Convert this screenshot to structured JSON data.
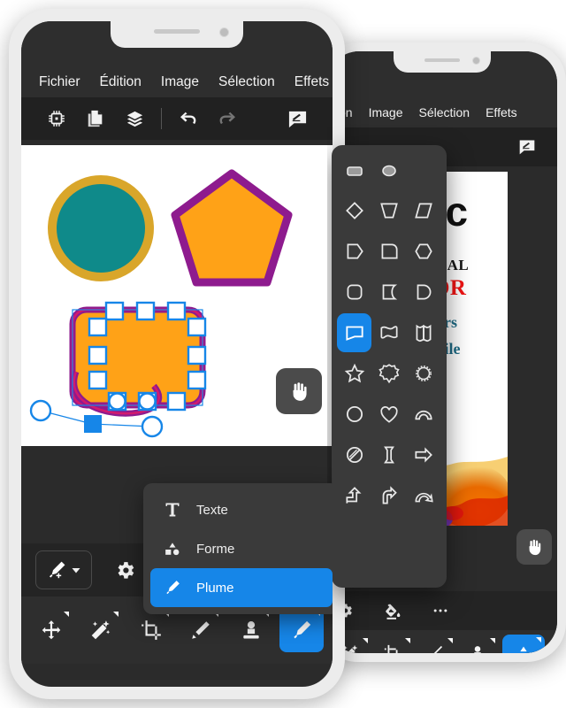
{
  "app": {
    "accent_color": "#1686e8",
    "panel_color": "#3a3a3a",
    "chrome_color": "#2e2e2e",
    "toolbar_color": "#212121"
  },
  "front_phone": {
    "menubar": {
      "items": [
        {
          "label": "Fichier",
          "name": "menu-fichier"
        },
        {
          "label": "Édition",
          "name": "menu-edition"
        },
        {
          "label": "Image",
          "name": "menu-image"
        },
        {
          "label": "Sélection",
          "name": "menu-selection"
        },
        {
          "label": "Effets",
          "name": "menu-effets"
        }
      ]
    },
    "toolbar": {
      "items": [
        {
          "icon": "chip-icon",
          "name": "tool-chip"
        },
        {
          "icon": "documents-icon",
          "name": "tool-documents"
        },
        {
          "icon": "layers-icon",
          "name": "tool-layers"
        },
        {
          "icon": "undo-icon",
          "name": "tool-undo"
        },
        {
          "icon": "redo-icon",
          "name": "tool-redo",
          "disabled": true
        },
        {
          "icon": "signature-icon",
          "name": "tool-signature"
        }
      ]
    },
    "canvas": {
      "shapes": [
        {
          "name": "circle-shape",
          "type": "circle",
          "fill": "#0f8a8a",
          "stroke": "#d9a62a"
        },
        {
          "name": "pentagon-shape",
          "type": "pentagon",
          "fill": "#ffa217",
          "stroke": "#8e1b8e"
        },
        {
          "name": "rounded-rect-shape",
          "type": "rounded-rect",
          "fill": "#ffa217",
          "stroke": "#8e1b8e",
          "selected": true
        }
      ],
      "selection": {
        "handle_fill": "#ffffff",
        "handle_stroke": "#1686e8",
        "anchor_fill": "#1686e8"
      },
      "pan_button": {
        "icon": "hand-icon",
        "name": "pan-button"
      }
    },
    "option_bar": {
      "pen_tool": {
        "icon": "pen-add-icon",
        "name": "pen-tool-button",
        "has_dropdown": true
      },
      "settings": {
        "icon": "gear-icon",
        "name": "settings-button"
      }
    },
    "popup_menu": {
      "items": [
        {
          "label": "Texte",
          "icon": "text-icon",
          "name": "menu-item-texte",
          "selected": false
        },
        {
          "label": "Forme",
          "icon": "shapes-icon",
          "name": "menu-item-forme",
          "selected": false
        },
        {
          "label": "Plume",
          "icon": "pen-icon",
          "name": "menu-item-plume",
          "selected": true
        }
      ]
    },
    "tabbar": {
      "items": [
        {
          "icon": "move-icon",
          "name": "tab-move",
          "active": false
        },
        {
          "icon": "magic-wand-icon",
          "name": "tab-magic-wand",
          "active": false
        },
        {
          "icon": "crop-icon",
          "name": "tab-crop",
          "active": false
        },
        {
          "icon": "pencil-icon",
          "name": "tab-pencil",
          "active": false
        },
        {
          "icon": "stamp-icon",
          "name": "tab-stamp",
          "active": false
        },
        {
          "icon": "pen-icon",
          "name": "tab-pen",
          "active": true
        }
      ]
    }
  },
  "back_phone": {
    "menubar": {
      "items": [
        {
          "label": "tion",
          "name": "menu-edition-clipped"
        },
        {
          "label": "Image",
          "name": "menu-image"
        },
        {
          "label": "Sélection",
          "name": "menu-selection"
        },
        {
          "label": "Effets",
          "name": "menu-effets"
        }
      ]
    },
    "toolbar": {
      "items": [
        {
          "icon": "signature-icon",
          "name": "tool-signature"
        }
      ]
    },
    "shape_panel": {
      "name": "shape-picker-panel",
      "shapes": [
        {
          "icon": "rounded-rect-filled-icon",
          "name": "shape-rounded-rect-filled",
          "selected": false
        },
        {
          "icon": "ellipse-filled-icon",
          "name": "shape-ellipse-filled",
          "selected": false
        },
        {
          "icon": "diamond-icon",
          "name": "shape-diamond",
          "selected": false
        },
        {
          "icon": "trapezoid-icon",
          "name": "shape-trapezoid",
          "selected": false
        },
        {
          "icon": "parallelogram-icon",
          "name": "shape-parallelogram",
          "selected": false
        },
        {
          "icon": "pentagon-tag-icon",
          "name": "shape-pentagon-tag",
          "selected": false
        },
        {
          "icon": "square-round-icon",
          "name": "shape-square-round",
          "selected": false
        },
        {
          "icon": "hexagon-icon",
          "name": "shape-hexagon",
          "selected": false
        },
        {
          "icon": "rounded-square-icon",
          "name": "shape-rounded-square",
          "selected": false
        },
        {
          "icon": "half-moon-icon",
          "name": "shape-half-moon",
          "selected": false
        },
        {
          "icon": "d-shape-icon",
          "name": "shape-d",
          "selected": false
        },
        {
          "icon": "flag-icon",
          "name": "shape-flag",
          "selected": true
        },
        {
          "icon": "wave-flag-icon",
          "name": "shape-wave-flag",
          "selected": false
        },
        {
          "icon": "banner-icon",
          "name": "shape-banner",
          "selected": false
        },
        {
          "icon": "star-icon",
          "name": "shape-star",
          "selected": false
        },
        {
          "icon": "burst-icon",
          "name": "shape-burst",
          "selected": false
        },
        {
          "icon": "sunburst-icon",
          "name": "shape-sunburst",
          "selected": false
        },
        {
          "icon": "circle-outline-icon",
          "name": "shape-circle",
          "selected": false
        },
        {
          "icon": "heart-icon",
          "name": "shape-heart",
          "selected": false
        },
        {
          "icon": "arc-icon",
          "name": "shape-arc",
          "selected": false
        },
        {
          "icon": "no-entry-icon",
          "name": "shape-no-entry",
          "selected": false
        },
        {
          "icon": "double-arrow-icon",
          "name": "shape-double-arrow",
          "selected": false
        },
        {
          "icon": "arrow-right-icon",
          "name": "shape-arrow-right",
          "selected": false
        },
        {
          "icon": "bent-arrow-icon",
          "name": "shape-bent-arrow",
          "selected": false
        },
        {
          "icon": "curved-arrow-icon",
          "name": "shape-curved-arrow",
          "selected": false
        },
        {
          "icon": "arc-arrow-icon",
          "name": "shape-arc-arrow",
          "selected": false
        }
      ]
    },
    "poster": {
      "lines": [
        {
          "text": "Pic",
          "name": "poster-title",
          "style": "t1"
        },
        {
          "text": "SIONAL",
          "name": "poster-subtitle",
          "style": "t2"
        },
        {
          "text": "ITOR",
          "name": "poster-subtitle-red",
          "style": "t3"
        },
        {
          "text": "Layers",
          "name": "poster-feature-1",
          "style": "t4"
        },
        {
          "text": "SD File",
          "name": "poster-feature-2",
          "style": "t4"
        }
      ]
    },
    "option_bar": {
      "items": [
        {
          "icon": "gear-icon",
          "name": "settings-button"
        },
        {
          "icon": "paint-bucket-icon",
          "name": "fill-button"
        },
        {
          "icon": "more-icon",
          "name": "more-button"
        }
      ]
    },
    "tabbar": {
      "items": [
        {
          "icon": "magic-wand-icon",
          "name": "tab-magic-wand",
          "active": false
        },
        {
          "icon": "crop-icon",
          "name": "tab-crop",
          "active": false
        },
        {
          "icon": "brush-icon",
          "name": "tab-brush",
          "active": false
        },
        {
          "icon": "stamp-icon",
          "name": "tab-stamp",
          "active": false
        },
        {
          "icon": "shapes-icon",
          "name": "tab-shapes",
          "active": true
        }
      ]
    },
    "pan_button": {
      "icon": "hand-icon",
      "name": "pan-button"
    }
  }
}
